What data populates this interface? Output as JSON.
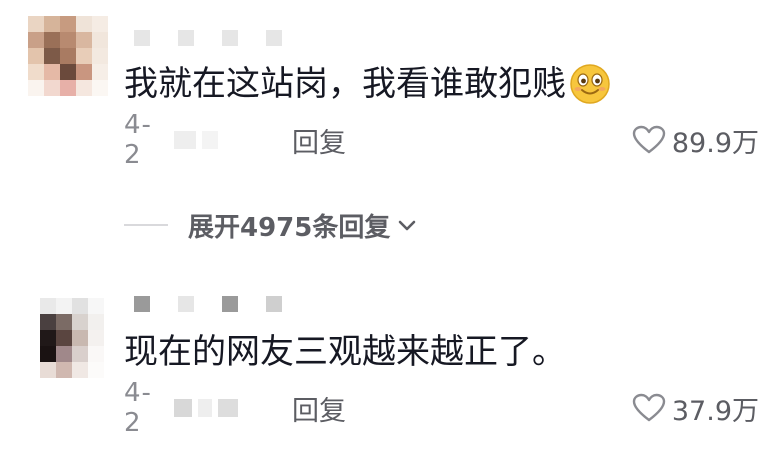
{
  "comments": [
    {
      "text": "我就在这站岗，我看谁敢犯贱",
      "emoji": "smiling-face-icon",
      "date": "4-2",
      "reply_label": "回复",
      "likes": "89.9万",
      "expand_label": "展开4975条回复"
    },
    {
      "text": "现在的网友三观越来越正了。",
      "date": "4-2",
      "reply_label": "回复",
      "likes": "37.9万"
    }
  ],
  "colors": {
    "text": "#161823",
    "meta": "#8a8b91",
    "action": "#5c5d63",
    "emoji_face": "#f7c63d"
  }
}
